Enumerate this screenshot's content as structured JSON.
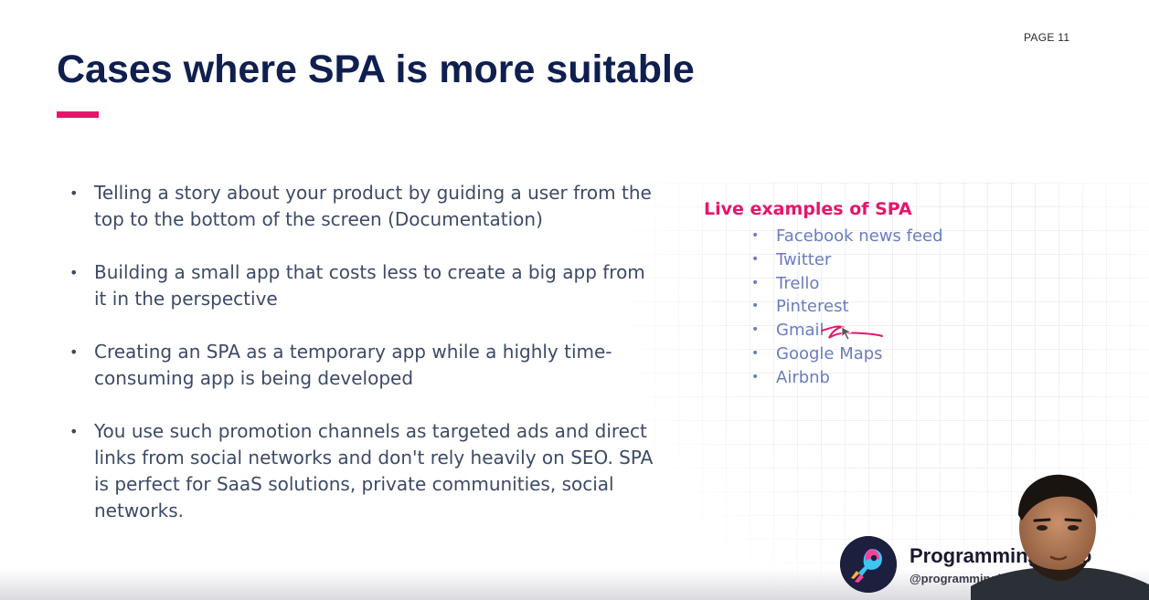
{
  "page_number": "PAGE 11",
  "title": "Cases where SPA is more suitable",
  "colors": {
    "title": "#0f1f4f",
    "accent": "#e8146c",
    "body_text": "#3c4a66",
    "example_text": "#6a7cc2"
  },
  "bullets": [
    "Telling a story about your product by guiding a user from the top to the bottom of the screen (Documentation)",
    "Building a small app that costs less to create a big app from it in the perspective",
    "Creating an SPA as a temporary app while a highly time-consuming app is being developed",
    "You use such promotion channels as targeted ads and direct links from social networks and don't rely heavily on SEO. SPA is perfect for SaaS solutions, private communities, social networks."
  ],
  "examples": {
    "heading": "Live examples of SPA",
    "items": [
      "Facebook news feed",
      "Twitter",
      "Trello",
      "Pinterest",
      "Gmail",
      "Google Maps",
      "Airbnb"
    ]
  },
  "brand": {
    "name": "Programming Hero",
    "handle": "@programminghero"
  }
}
